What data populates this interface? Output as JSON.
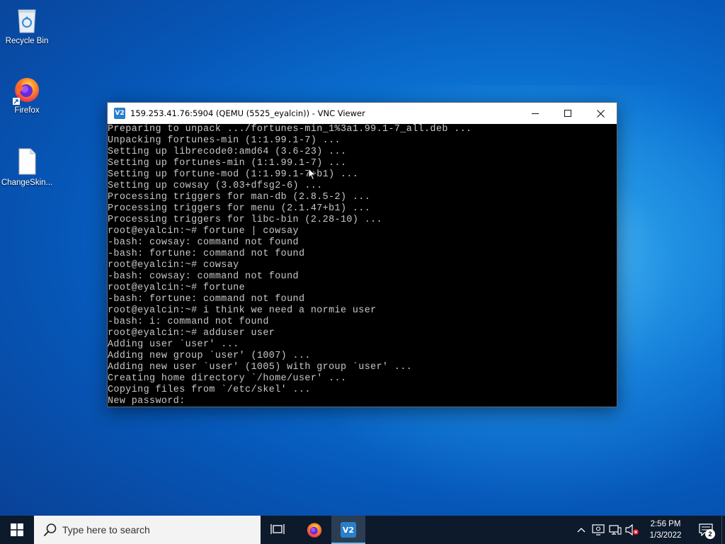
{
  "desktop": {
    "icons": [
      {
        "label": "Recycle Bin",
        "icon": "recycle-bin-icon"
      },
      {
        "label": "Firefox",
        "icon": "firefox-icon"
      },
      {
        "label": "ChangeSkin...",
        "icon": "file-icon"
      }
    ]
  },
  "window": {
    "title": "159.253.41.76:5904 (QEMU (5525_eyalcin)) - VNC Viewer",
    "app_icon_text": "V2",
    "controls": [
      "minimize",
      "maximize",
      "close"
    ]
  },
  "terminal": {
    "lines": [
      "Preparing to unpack .../fortunes-min_1%3a1.99.1-7_all.deb ...",
      "Unpacking fortunes-min (1:1.99.1-7) ...",
      "Setting up librecode0:amd64 (3.6-23) ...",
      "Setting up fortunes-min (1:1.99.1-7) ...",
      "Setting up fortune-mod (1:1.99.1-7+b1) ...",
      "Setting up cowsay (3.03+dfsg2-6) ...",
      "Processing triggers for man-db (2.8.5-2) ...",
      "Processing triggers for menu (2.1.47+b1) ...",
      "Processing triggers for libc-bin (2.28-10) ...",
      "root@eyalcin:~# fortune | cowsay",
      "-bash: cowsay: command not found",
      "-bash: fortune: command not found",
      "root@eyalcin:~# cowsay",
      "-bash: cowsay: command not found",
      "root@eyalcin:~# fortune",
      "-bash: fortune: command not found",
      "root@eyalcin:~# i think we need a normie user",
      "-bash: i: command not found",
      "root@eyalcin:~# adduser user",
      "Adding user `user' ...",
      "Adding new group `user' (1007) ...",
      "Adding new user `user' (1005) with group `user' ...",
      "Creating home directory `/home/user' ...",
      "Copying files from `/etc/skel' ...",
      "New password:"
    ]
  },
  "taskbar": {
    "search_placeholder": "Type here to search",
    "pinned": [
      {
        "name": "task-view",
        "icon": "task-view-icon"
      },
      {
        "name": "firefox",
        "icon": "firefox-icon"
      },
      {
        "name": "vnc-viewer",
        "icon": "vnc-viewer-icon",
        "active": true
      }
    ],
    "tray": {
      "time": "2:56 PM",
      "date": "1/3/2022",
      "notification_count": "2"
    }
  },
  "colors": {
    "terminal_bg": "#000000",
    "terminal_fg": "#c8c8c8",
    "taskbar_bg": "#0c1a2b",
    "accent": "#76b9ed"
  }
}
